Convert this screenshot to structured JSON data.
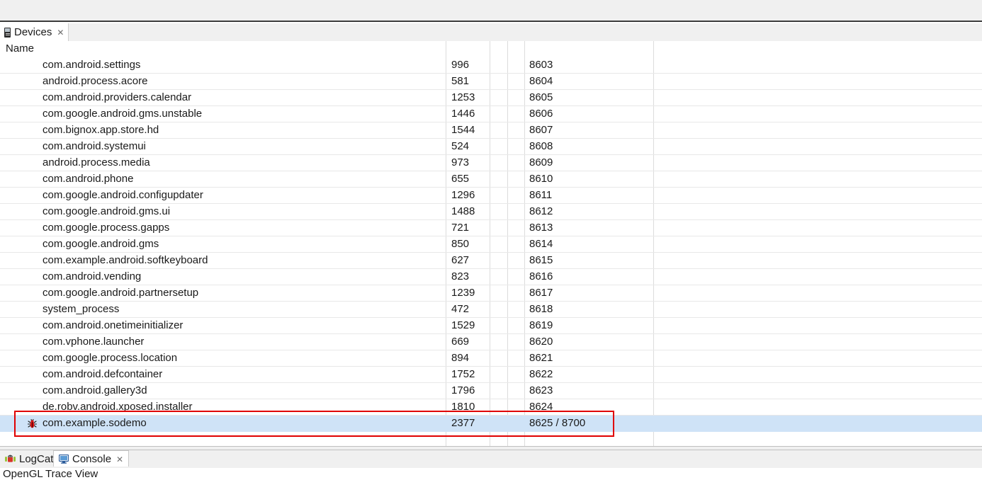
{
  "window": {
    "toolbar_empty": true
  },
  "devices_view": {
    "tab": {
      "label": "Devices",
      "icon": "phone-icon",
      "close_glyph": "✕",
      "active": true
    },
    "columns": {
      "name_header": "Name"
    },
    "rows": [
      {
        "name": "com.android.settings",
        "pid": "996",
        "port": "8603",
        "icon": null
      },
      {
        "name": "android.process.acore",
        "pid": "581",
        "port": "8604",
        "icon": null
      },
      {
        "name": "com.android.providers.calendar",
        "pid": "1253",
        "port": "8605",
        "icon": null
      },
      {
        "name": "com.google.android.gms.unstable",
        "pid": "1446",
        "port": "8606",
        "icon": null
      },
      {
        "name": "com.bignox.app.store.hd",
        "pid": "1544",
        "port": "8607",
        "icon": null
      },
      {
        "name": "com.android.systemui",
        "pid": "524",
        "port": "8608",
        "icon": null
      },
      {
        "name": "android.process.media",
        "pid": "973",
        "port": "8609",
        "icon": null
      },
      {
        "name": "com.android.phone",
        "pid": "655",
        "port": "8610",
        "icon": null
      },
      {
        "name": "com.google.android.configupdater",
        "pid": "1296",
        "port": "8611",
        "icon": null
      },
      {
        "name": "com.google.android.gms.ui",
        "pid": "1488",
        "port": "8612",
        "icon": null
      },
      {
        "name": "com.google.process.gapps",
        "pid": "721",
        "port": "8613",
        "icon": null
      },
      {
        "name": "com.google.android.gms",
        "pid": "850",
        "port": "8614",
        "icon": null
      },
      {
        "name": "com.example.android.softkeyboard",
        "pid": "627",
        "port": "8615",
        "icon": null
      },
      {
        "name": "com.android.vending",
        "pid": "823",
        "port": "8616",
        "icon": null
      },
      {
        "name": "com.google.android.partnersetup",
        "pid": "1239",
        "port": "8617",
        "icon": null
      },
      {
        "name": "system_process",
        "pid": "472",
        "port": "8618",
        "icon": null
      },
      {
        "name": "com.android.onetimeinitializer",
        "pid": "1529",
        "port": "8619",
        "icon": null
      },
      {
        "name": "com.vphone.launcher",
        "pid": "669",
        "port": "8620",
        "icon": null
      },
      {
        "name": "com.google.process.location",
        "pid": "894",
        "port": "8621",
        "icon": null
      },
      {
        "name": "com.android.defcontainer",
        "pid": "1752",
        "port": "8622",
        "icon": null
      },
      {
        "name": "com.android.gallery3d",
        "pid": "1796",
        "port": "8623",
        "icon": null
      },
      {
        "name": "de.robv.android.xposed.installer",
        "pid": "1810",
        "port": "8624",
        "icon": null
      },
      {
        "name": "com.example.sodemo",
        "pid": "2377",
        "port": "8625 / 8700",
        "icon": "bug-icon",
        "selected": true
      }
    ]
  },
  "annotation": {
    "color": "#e00000",
    "target_row": "com.example.sodemo"
  },
  "bottom_panel": {
    "tabs": [
      {
        "label": "LogCat",
        "icon": "android-icon",
        "active": false,
        "close_glyph": ""
      },
      {
        "label": "Console",
        "icon": "monitor-icon",
        "active": true,
        "close_glyph": "✕"
      }
    ],
    "overflow_label": "OpenGL Trace View"
  }
}
